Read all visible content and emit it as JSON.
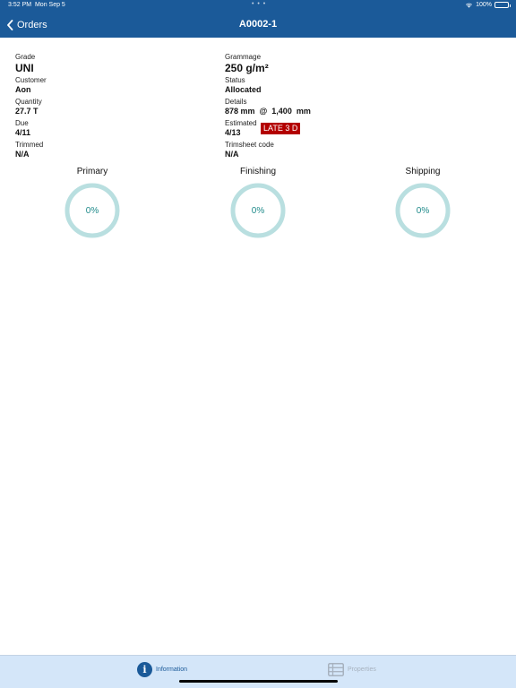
{
  "status_bar": {
    "time": "3:52 PM",
    "date": "Mon Sep 5",
    "dots": "• • •",
    "battery": "100%"
  },
  "nav": {
    "back_label": "Orders",
    "title": "A0002-1"
  },
  "details": {
    "grade": {
      "label": "Grade",
      "value": "UNI"
    },
    "grammage": {
      "label": "Grammage",
      "value": "250 g/m²"
    },
    "customer": {
      "label": "Customer",
      "value": "Aon"
    },
    "status": {
      "label": "Status",
      "value": "Allocated"
    },
    "quantity": {
      "label": "Quantity",
      "value": "27.7 T"
    },
    "details": {
      "label": "Details",
      "value": "878 mm  @  1,400  mm"
    },
    "due": {
      "label": "Due",
      "value": "4/11"
    },
    "estimated": {
      "label": "Estimated",
      "value": "4/13",
      "badge": "LATE 3 D"
    },
    "trimmed": {
      "label": "Trimmed",
      "value": "N/A"
    },
    "trimsheet_code": {
      "label": "Trimsheet code",
      "value": "N/A"
    }
  },
  "progress": [
    {
      "title": "Primary",
      "value": "0%",
      "fraction": 0
    },
    {
      "title": "Finishing",
      "value": "0%",
      "fraction": 0
    },
    {
      "title": "Shipping",
      "value": "0%",
      "fraction": 0
    }
  ],
  "tab_bar": {
    "information_label": "Information",
    "properties_label": "Properties"
  },
  "colors": {
    "header": "#1b5a99",
    "ring": "#b9dfe0",
    "late_badge": "#b30000",
    "tab_bar": "#d4e6f9"
  }
}
